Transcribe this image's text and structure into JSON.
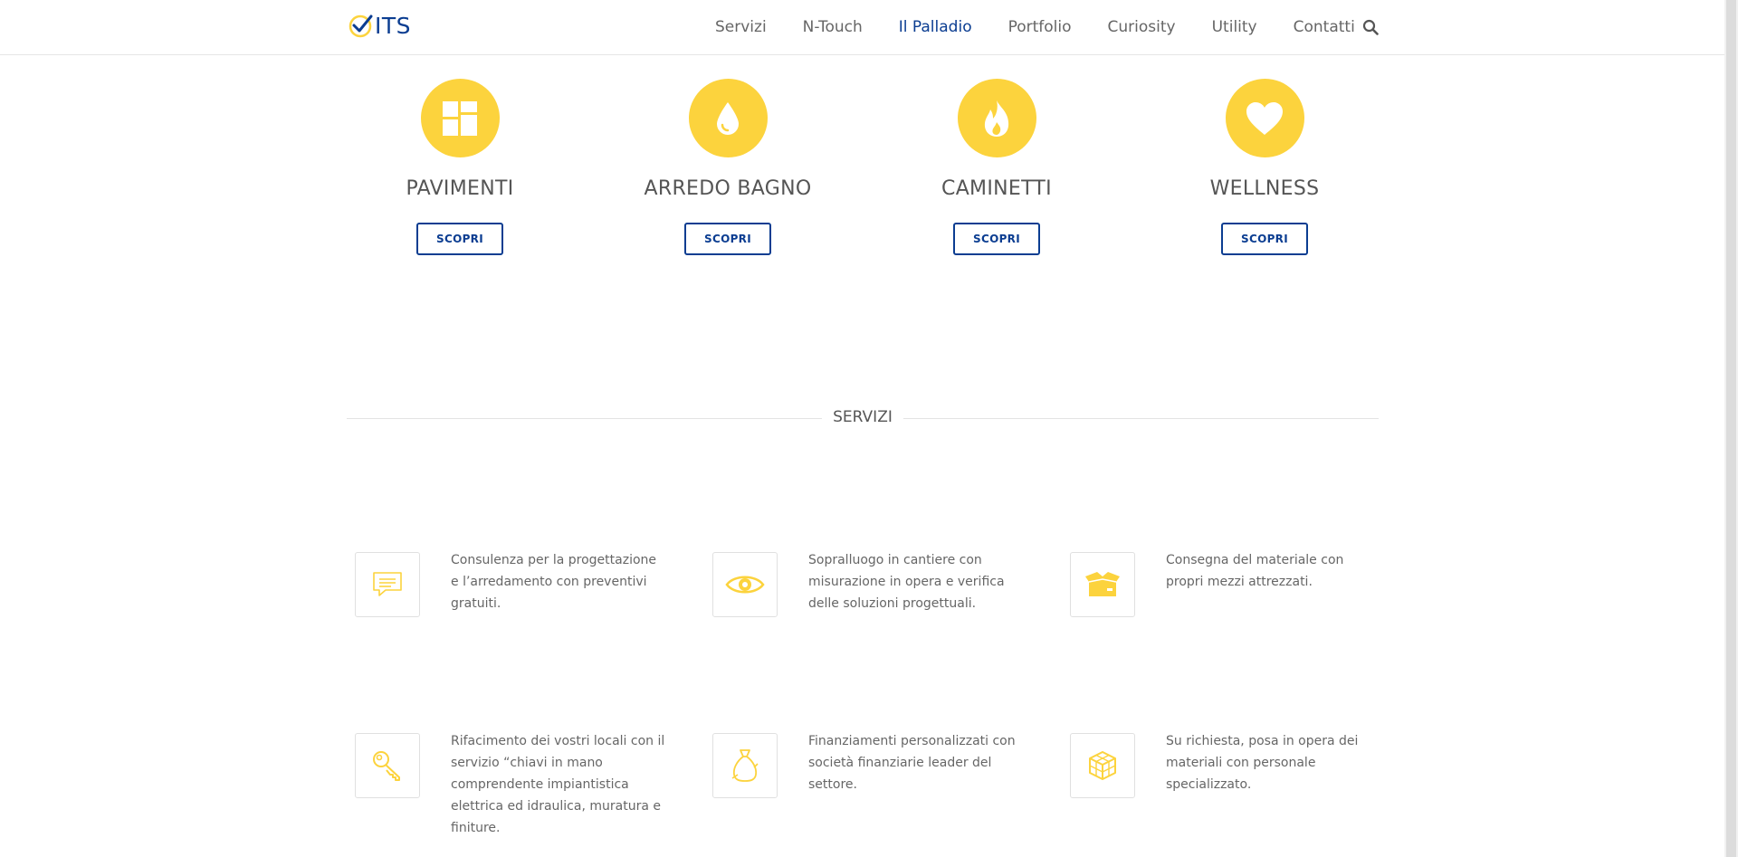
{
  "header": {
    "logo_text": "ITS",
    "nav": [
      "Servizi",
      "N-Touch",
      "Il Palladio",
      "Portfolio",
      "Curiosity",
      "Utility",
      "Contatti"
    ],
    "active_nav": "Il Palladio"
  },
  "categories": [
    {
      "title": "PAVIMENTI",
      "button": "SCOPRI",
      "icon": "tiles-icon"
    },
    {
      "title": "ARREDO BAGNO",
      "button": "SCOPRI",
      "icon": "water-drop-icon"
    },
    {
      "title": "CAMINETTI",
      "button": "SCOPRI",
      "icon": "fire-icon"
    },
    {
      "title": "WELLNESS",
      "button": "SCOPRI",
      "icon": "heart-icon"
    }
  ],
  "services_title": "SERVIZI",
  "services": [
    {
      "text": "Consulenza per la progettazione e l’arredamento con preventivi gratuiti.",
      "icon": "chat-bubble-icon"
    },
    {
      "text": "Sopralluogo in cantiere con misurazione in opera e verifica delle soluzioni progettuali.",
      "icon": "eye-icon"
    },
    {
      "text": "Consegna del materiale con propri mezzi attrezzati.",
      "icon": "open-box-icon"
    },
    {
      "text": "Rifacimento dei vostri locali con il servizio “chiavi in mano comprendente impiantistica elettrica ed idraulica, muratura e finiture.",
      "icon": "key-icon"
    },
    {
      "text": "Finanziamenti personalizzati con società finanziarie leader del settore.",
      "icon": "money-bag-icon"
    },
    {
      "text": "Su richiesta, posa in opera dei materiali con personale specializzato.",
      "icon": "cube-icon"
    }
  ],
  "colors": {
    "accent": "#fcd33d",
    "brand": "#0b3d91",
    "text": "#555555"
  }
}
